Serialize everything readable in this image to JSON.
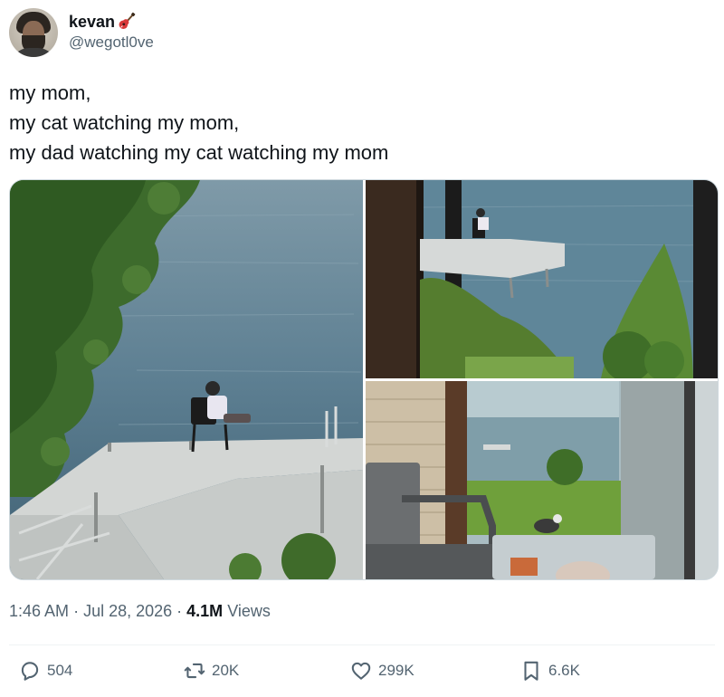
{
  "author": {
    "display_name": "kevan",
    "handle": "@wegotl0ve",
    "name_emoji": "guitar-icon"
  },
  "tweet": {
    "lines": [
      "my mom,",
      "my cat watching my mom,",
      "my dad watching my cat watching my mom"
    ]
  },
  "media": {
    "count": 3,
    "photos": [
      "photo-mom-on-dock",
      "photo-cat-watching-mom",
      "photo-dad-watching-cat"
    ]
  },
  "meta": {
    "time": "1:46 AM",
    "date": "Jul 28, 2026",
    "views_count": "4.1M",
    "views_label": "Views"
  },
  "actions": {
    "replies": "504",
    "reposts": "20K",
    "likes": "299K",
    "bookmarks": "6.6K"
  },
  "colors": {
    "text": "#0f1419",
    "secondary": "#536471",
    "border": "#cfd9de",
    "water": "#5d7f92"
  }
}
